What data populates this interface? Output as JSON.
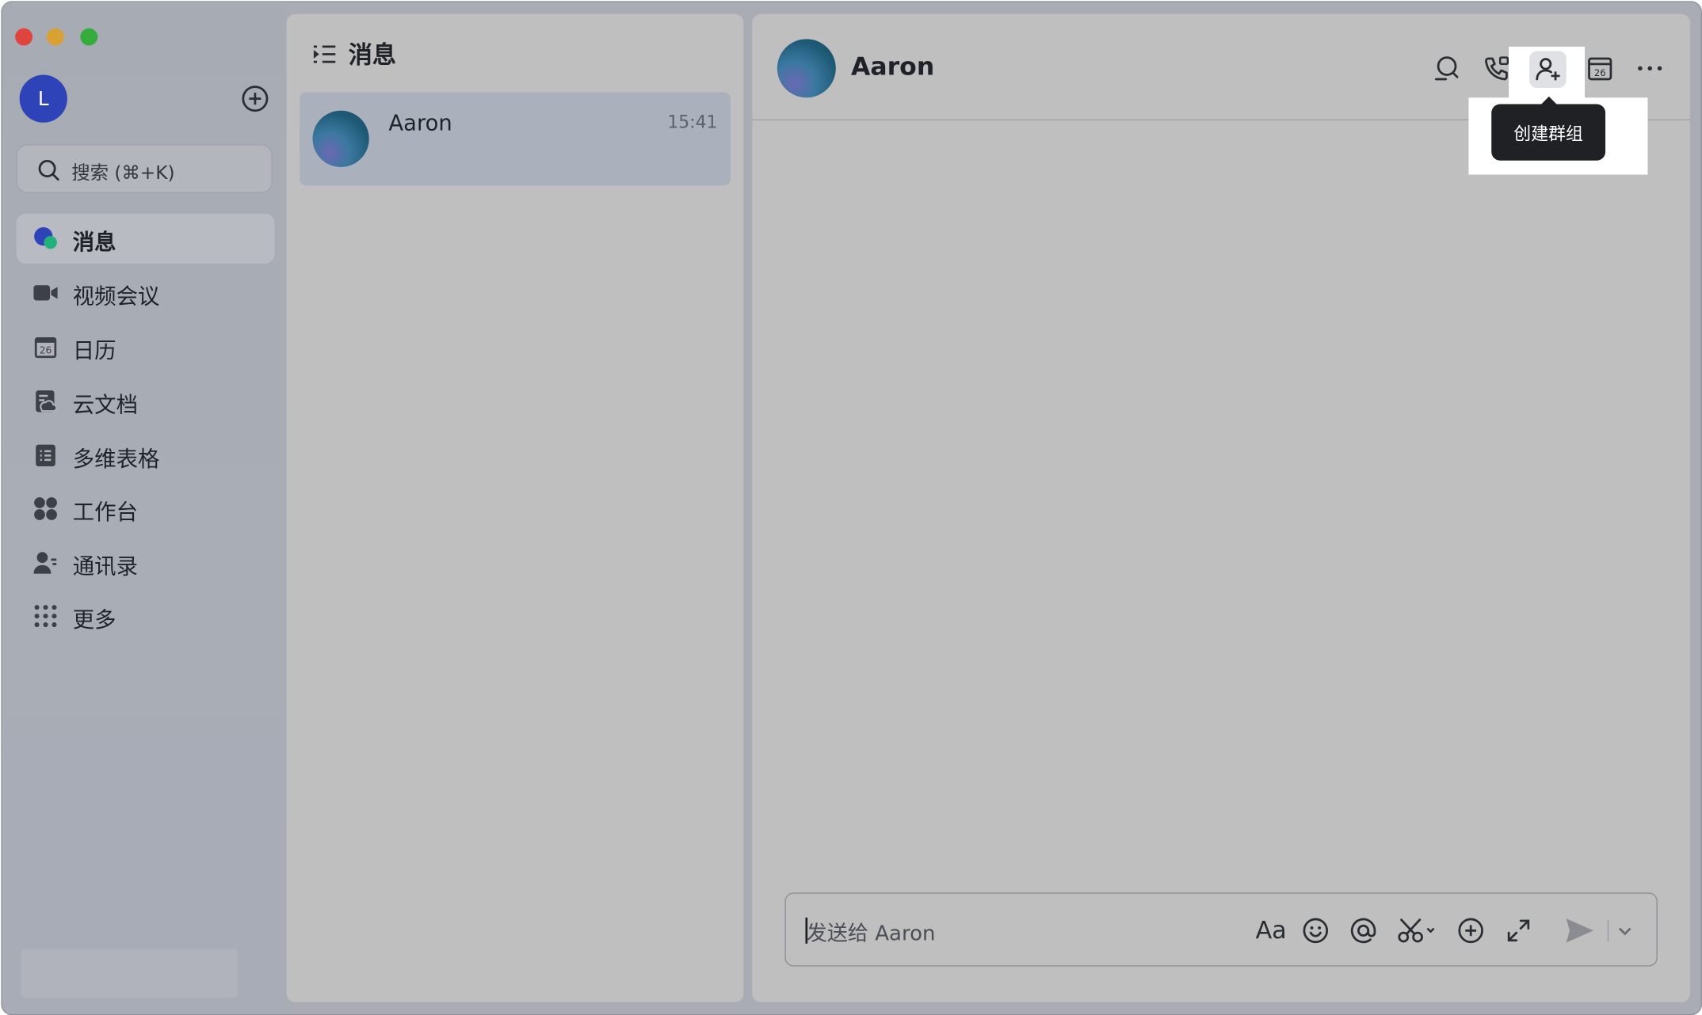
{
  "sidebar": {
    "avatar_initial": "L",
    "search_placeholder": "搜索 (⌘+K)",
    "items": [
      {
        "label": "消息",
        "icon": "message-bubble-icon",
        "active": true
      },
      {
        "label": "视频会议",
        "icon": "video-camera-icon"
      },
      {
        "label": "日历",
        "icon": "calendar-icon",
        "date": "26"
      },
      {
        "label": "云文档",
        "icon": "cloud-document-icon"
      },
      {
        "label": "多维表格",
        "icon": "base-table-icon"
      },
      {
        "label": "工作台",
        "icon": "workplace-grid-icon"
      },
      {
        "label": "通讯录",
        "icon": "contacts-icon"
      },
      {
        "label": "更多",
        "icon": "more-dots-grid-icon"
      }
    ]
  },
  "list": {
    "title": "消息",
    "conversations": [
      {
        "name": "Aaron",
        "time": "15:41"
      }
    ]
  },
  "chat": {
    "title": "Aaron",
    "tooltip": "创建群组",
    "calendar_date": "26",
    "composer_placeholder": "发送给 Aaron",
    "format_label": "Aa"
  },
  "colors": {
    "accent_blue": "#2e43b8",
    "tooltip_bg": "#1f2124"
  }
}
